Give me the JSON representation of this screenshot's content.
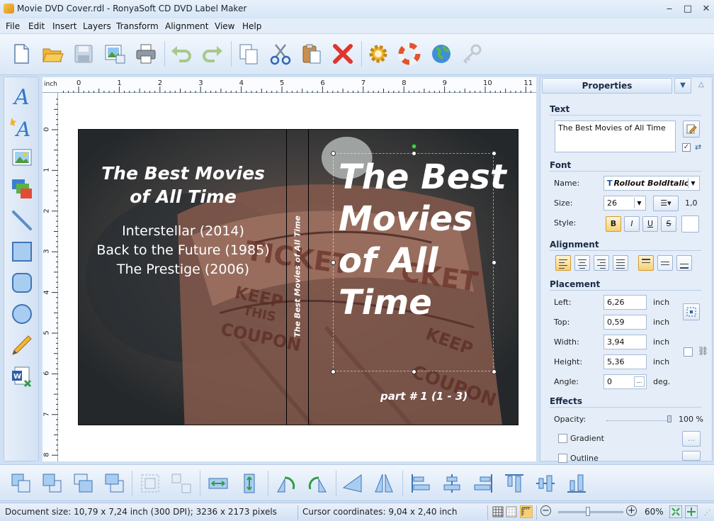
{
  "window": {
    "title": "Movie DVD Cover.rdl - RonyaSoft CD DVD Label Maker",
    "minimize": "‒",
    "maximize": "□",
    "close": "✕"
  },
  "menu": [
    "File",
    "Edit",
    "Insert",
    "Layers",
    "Transform",
    "Alignment",
    "View",
    "Help"
  ],
  "toolbar": [
    "new-document",
    "open-folder",
    "save",
    "image-export",
    "print",
    "undo",
    "redo",
    "copy",
    "cut",
    "paste",
    "delete",
    "settings",
    "help-lifebuoy",
    "web-globe",
    "key"
  ],
  "left_tools": [
    "text-tool",
    "curved-text-tool",
    "image-tool",
    "background-tool",
    "line-tool",
    "rectangle-tool",
    "rounded-rectangle-tool",
    "ellipse-tool",
    "pencil-tool",
    "import-word-tool"
  ],
  "ruler": {
    "unit": "inch",
    "top_labels": [
      "0",
      "1",
      "2",
      "3",
      "4",
      "5",
      "6",
      "7",
      "8",
      "9",
      "10",
      "11"
    ],
    "left_labels": [
      "0",
      "1",
      "2",
      "3",
      "4",
      "5",
      "6",
      "7",
      "8"
    ]
  },
  "cover": {
    "back_title": "The Best Movies\nof All Time",
    "back_lines": [
      "Interstellar (2014)",
      "Back to the Future (1985)",
      "The Prestige (2006)"
    ],
    "spine_text": "The Best Movies of All Time",
    "front_title": "The Best\nMovies\nof All\nTime",
    "part": "part # 1 (1 - 3)"
  },
  "properties": {
    "header": "Properties",
    "text_section": "Text",
    "text_value": "The Best Movies of All Time",
    "font_section": "Font",
    "name_label": "Name:",
    "font_name": "Rollout BoldItalic",
    "size_label": "Size:",
    "font_size": "26",
    "line_spacing": "1,0",
    "style_label": "Style:",
    "style_buttons": [
      "B",
      "I",
      "U",
      "S"
    ],
    "alignment_section": "Alignment",
    "placement_section": "Placement",
    "left_label": "Left:",
    "left_value": "6,26",
    "top_label": "Top:",
    "top_value": "0,59",
    "width_label": "Width:",
    "width_value": "3,94",
    "height_label": "Height:",
    "height_value": "5,36",
    "angle_label": "Angle:",
    "angle_value": "0",
    "unit_inch": "inch",
    "unit_deg": "deg.",
    "effects_section": "Effects",
    "opacity_label": "Opacity:",
    "opacity_value": "100 %",
    "opacity_fraction": 1.0,
    "gradient_label": "Gradient",
    "outline_label": "Outline",
    "browse": "..."
  },
  "bottom_tools": [
    "bring-to-front",
    "send-to-back",
    "bring-forward",
    "send-backward",
    "group",
    "ungroup",
    "fit-width",
    "fit-height",
    "rotate-left",
    "rotate-right",
    "flip-horizontal",
    "flip-vertical",
    "align-left",
    "align-center",
    "align-right",
    "align-top",
    "align-middle",
    "align-bottom"
  ],
  "status": {
    "document_size": "Document size: 10,79 x 7,24 inch (300 DPI); 3236 x 2173 pixels",
    "cursor": "Cursor coordinates: 9,04 x 2,40 inch",
    "zoom": "60%",
    "zoom_minus": "−",
    "zoom_plus": "+",
    "zoom_fraction": 0.45
  },
  "colors": {
    "accent": "#2e6fcf",
    "window_bg": "#cfe0f3",
    "selected_style": "#f7cf75"
  }
}
